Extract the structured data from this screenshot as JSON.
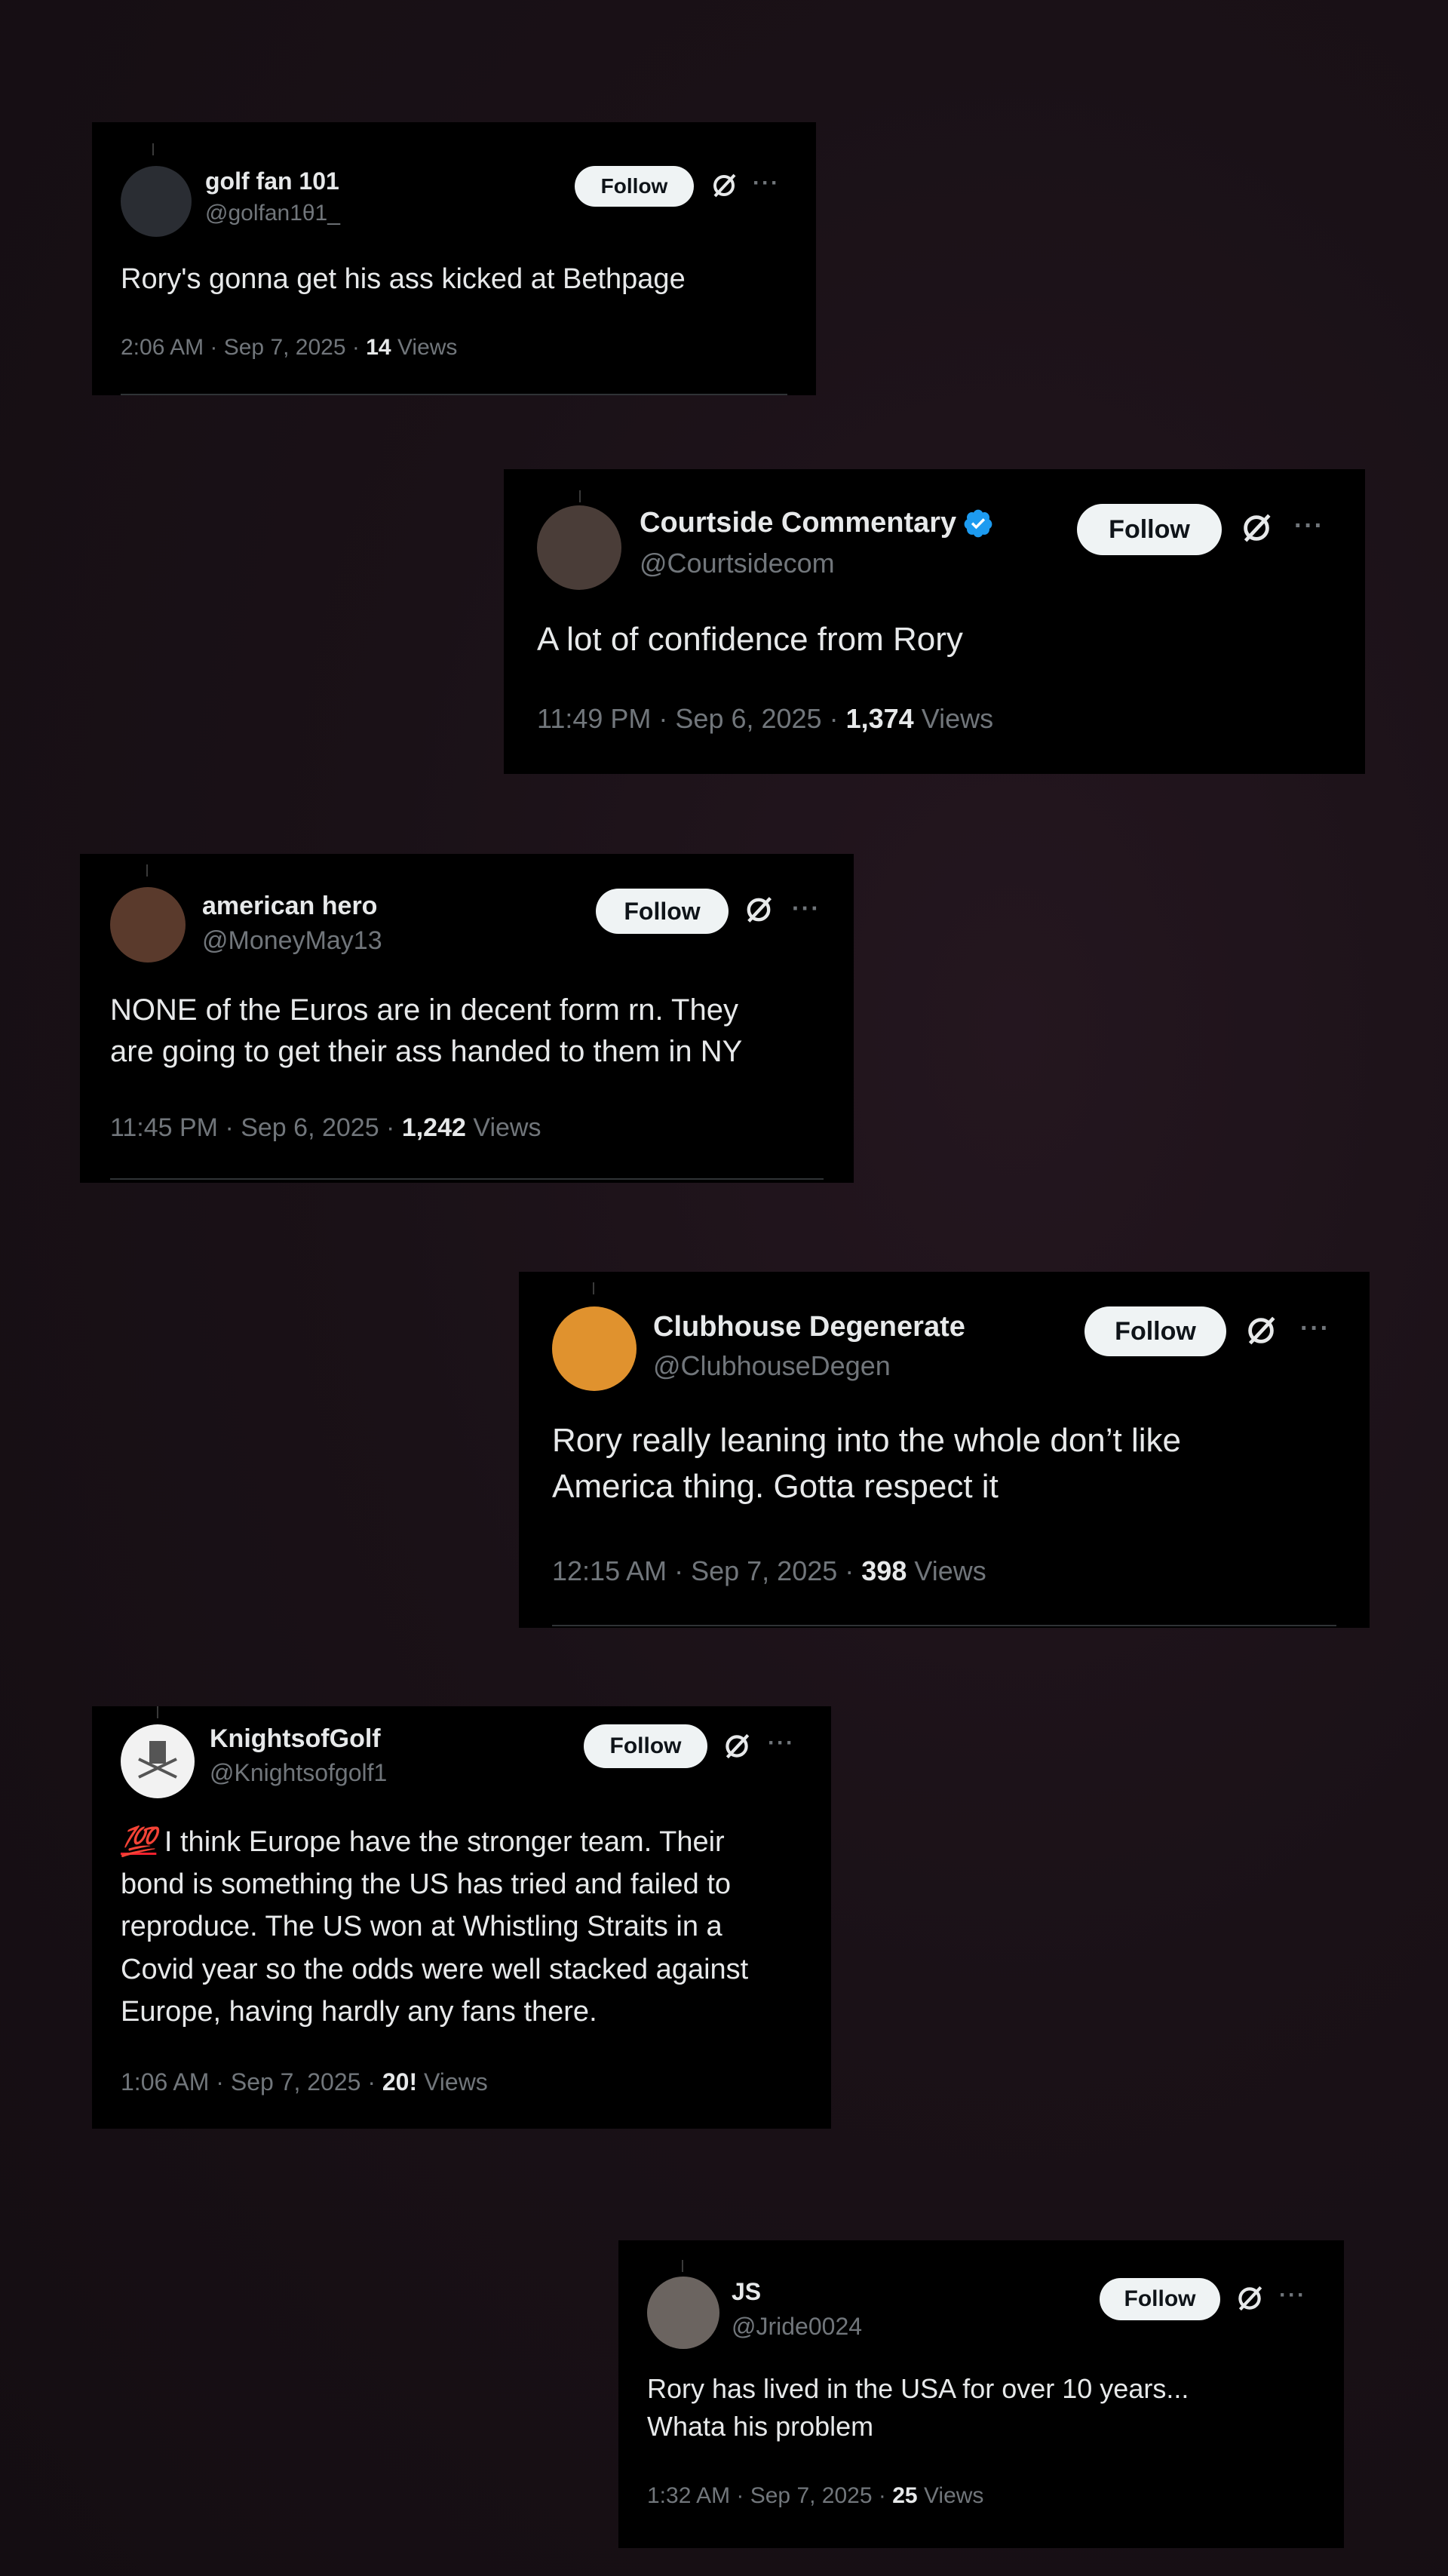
{
  "follow_label": "Follow",
  "views_label": "Views",
  "more_glyph": "···",
  "tweets": [
    {
      "name": "golf fan 101",
      "handle": "@golfan1θ1_",
      "text": "Rory's gonna get his ass kicked at Bethpage",
      "time": "2:06 AM · Sep 7, 2025 ·",
      "views": "14",
      "verified": false,
      "avatar_color": "#2a2d33"
    },
    {
      "name": "Courtside Commentary",
      "handle": "@Courtsidecom",
      "text": "A lot of confidence from Rory",
      "time": "11:49 PM · Sep 6, 2025 ·",
      "views": "1,374",
      "verified": true,
      "verified_color": "#1d9bf0",
      "avatar_color": "#4a3d38"
    },
    {
      "name": "american hero",
      "handle": "@MoneyMay13",
      "text_lines": [
        "NONE of the Euros are in decent form rn. They",
        "are going to get their ass handed to them in NY"
      ],
      "time": "11:45 PM · Sep 6, 2025 ·",
      "views": "1,242",
      "verified": false,
      "avatar_color": "#5a3a2c"
    },
    {
      "name": "Clubhouse Degenerate",
      "handle": "@ClubhouseDegen",
      "text_lines": [
        "Rory really leaning into the whole don’t like",
        "America thing. Gotta respect it"
      ],
      "time": "12:15 AM · Sep 7, 2025 ·",
      "views": "398",
      "verified": false,
      "avatar_color": "#e0922e"
    },
    {
      "name": "KnightsofGolf",
      "handle": "@Knightsofgolf1",
      "emoji": "💯",
      "text_lines": [
        " I think Europe have the stronger team. Their",
        "bond is something the US has tried and failed to",
        "reproduce. The US won at Whistling Straits in a",
        "Covid year so the odds were well stacked against",
        "Europe, having hardly any fans there."
      ],
      "time": "1:06 AM · Sep 7, 2025 ·",
      "views": "20!",
      "verified": false,
      "avatar_color": "#f2f2f2"
    },
    {
      "name": "JS",
      "handle": "@Jride0024",
      "text_lines": [
        "Rory has lived in the USA for over 10 years...",
        "Whata his problem"
      ],
      "time": "1:32 AM · Sep 7, 2025 ·",
      "views": "25",
      "verified": false,
      "avatar_color": "#6b6460"
    }
  ]
}
